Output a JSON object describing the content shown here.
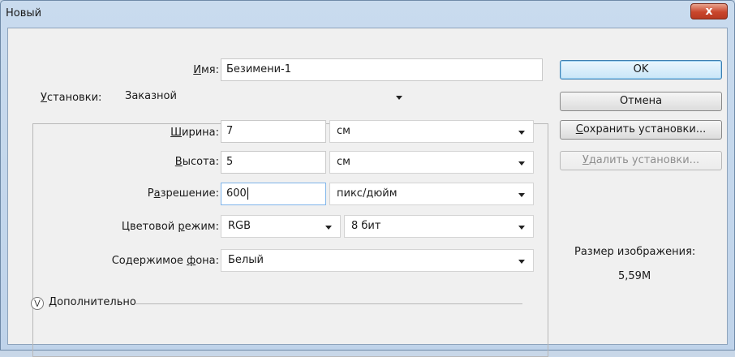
{
  "window": {
    "title": "Новый",
    "close_glyph": "x"
  },
  "form": {
    "name_label": "Имя:",
    "name_value": "Безимени-1",
    "preset_label": "Установки:",
    "preset_value": "Заказной",
    "width_label": "Ширина:",
    "width_value": "7",
    "width_unit": "см",
    "height_label": "Высота:",
    "height_value": "5",
    "height_unit": "см",
    "resolution_label": "Разрешение:",
    "resolution_value": "600",
    "resolution_unit": "пикс/дюйм",
    "color_mode_label": "Цветовой режим:",
    "color_mode_value": "RGB",
    "bit_depth_value": "8 бит",
    "background_label": "Содержимое фона:",
    "background_value": "Белый",
    "advanced_label": "Дополнительно"
  },
  "buttons": {
    "ok": "OK",
    "cancel": "Отмена",
    "save_preset": "Сохранить установки...",
    "delete_preset": "Удалить установки..."
  },
  "image_size": {
    "label": "Размер изображения:",
    "value": "5,59M"
  }
}
